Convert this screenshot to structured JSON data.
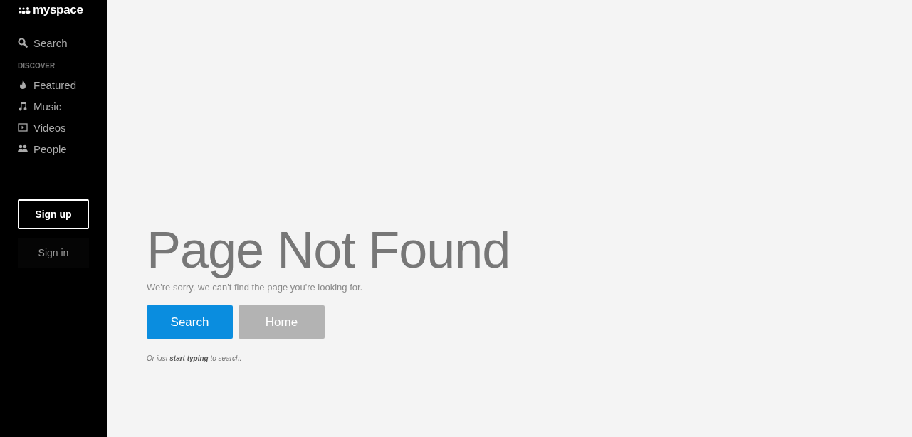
{
  "sidebar": {
    "logo": "myspace",
    "search": "Search",
    "section": "DISCOVER",
    "items": [
      {
        "kind": "featured",
        "label": "Featured"
      },
      {
        "kind": "music",
        "label": "Music"
      },
      {
        "kind": "videos",
        "label": "Videos"
      },
      {
        "kind": "people",
        "label": "People"
      }
    ],
    "sign_up": "Sign up",
    "sign_in": "Sign in"
  },
  "main": {
    "title": "Page Not Found",
    "message": "We're sorry, we can't find the page you're looking for.",
    "buttons": [
      {
        "kind": "primary",
        "label": "Search"
      },
      {
        "kind": "secondary",
        "label": "Home"
      }
    ],
    "hint": "Or just **start typing** to search."
  }
}
